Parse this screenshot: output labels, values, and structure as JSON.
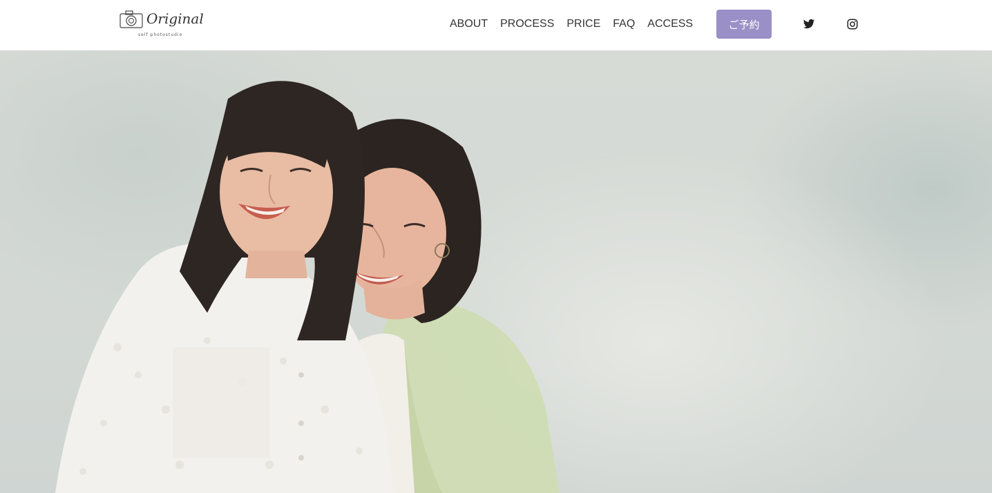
{
  "header": {
    "logo": {
      "text": "Original",
      "subtext": "self photostudio"
    },
    "nav": [
      {
        "label": "ABOUT"
      },
      {
        "label": "PROCESS"
      },
      {
        "label": "PRICE"
      },
      {
        "label": "FAQ"
      },
      {
        "label": "ACCESS"
      }
    ],
    "reserve_button": {
      "label": "ご予約",
      "color": "#9a8fc6"
    },
    "social": [
      {
        "icon": "twitter-icon"
      },
      {
        "icon": "instagram-icon"
      }
    ]
  },
  "hero": {
    "background_color": "#d6dad6"
  }
}
